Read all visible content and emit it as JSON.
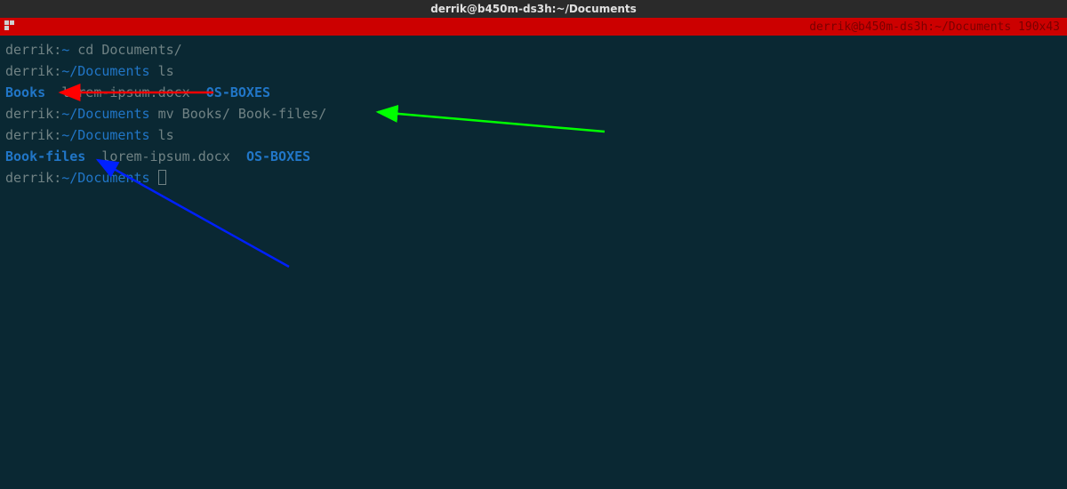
{
  "window": {
    "title": "derrik@b450m-ds3h:~/Documents"
  },
  "taskbar": {
    "label": "derrik@b450m-ds3h:~/Documents 190x43"
  },
  "lines": {
    "l1": {
      "user": "derrik",
      "sep": ":",
      "path": "~",
      "cmd": " cd Documents/"
    },
    "l2": {
      "user": "derrik",
      "sep": ":",
      "path": "~/Documents",
      "cmd": " ls"
    },
    "l3": {
      "d1": "Books",
      "sp1": "  ",
      "f1": "lorem-ipsum.docx",
      "sp2": "  ",
      "d2": "OS-BOXES"
    },
    "l4": {
      "user": "derrik",
      "sep": ":",
      "path": "~/Documents",
      "cmd": " mv Books/ Book-files/"
    },
    "l5": {
      "user": "derrik",
      "sep": ":",
      "path": "~/Documents",
      "cmd": " ls"
    },
    "l6": {
      "d1": "Book-files",
      "sp1": "  ",
      "f1": "lorem-ipsum.docx",
      "sp2": "  ",
      "d2": "OS-BOXES"
    },
    "l7": {
      "user": "derrik",
      "sep": ":",
      "path": "~/Documents",
      "cmd": " "
    }
  }
}
